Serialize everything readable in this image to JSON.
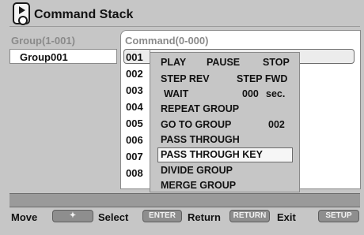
{
  "header": {
    "title": "Command Stack",
    "icon": "disc-play-icon"
  },
  "group_column": {
    "header": "Group(1-001)",
    "items": [
      {
        "label": "Group001"
      }
    ]
  },
  "command_column": {
    "header": "Command(0-000)",
    "row_numbers": [
      "001",
      "002",
      "003",
      "004",
      "005",
      "006",
      "007",
      "008"
    ]
  },
  "popup_menu": {
    "row1": {
      "a": "PLAY",
      "b": "PAUSE",
      "c": "STOP"
    },
    "row2": {
      "a": "STEP REV",
      "b": "STEP FWD"
    },
    "row3": {
      "a": "WAIT",
      "b": "000",
      "c": "sec."
    },
    "row4": {
      "a": "REPEAT GROUP"
    },
    "row5": {
      "a": "GO TO  GROUP",
      "b": "002"
    },
    "row6": {
      "a": "PASS THROUGH"
    },
    "row7": {
      "a": "PASS THROUGH KEY",
      "selected": true
    },
    "row8": {
      "a": "DIVIDE  GROUP"
    },
    "row9": {
      "a": "MERGE  GROUP"
    }
  },
  "status_bar": {
    "text": ""
  },
  "footer": {
    "move_label": "Move",
    "move_key": "✦",
    "select_label": "Select",
    "select_key": "ENTER",
    "return_label": "Return",
    "return_key": "RETURN",
    "exit_label": "Exit",
    "exit_key": "SETUP"
  },
  "colors": {
    "background": "#c6c6c6",
    "panel": "#ffffff",
    "selection": "#f6f6f6",
    "key_fill": "#8e8e8e"
  }
}
